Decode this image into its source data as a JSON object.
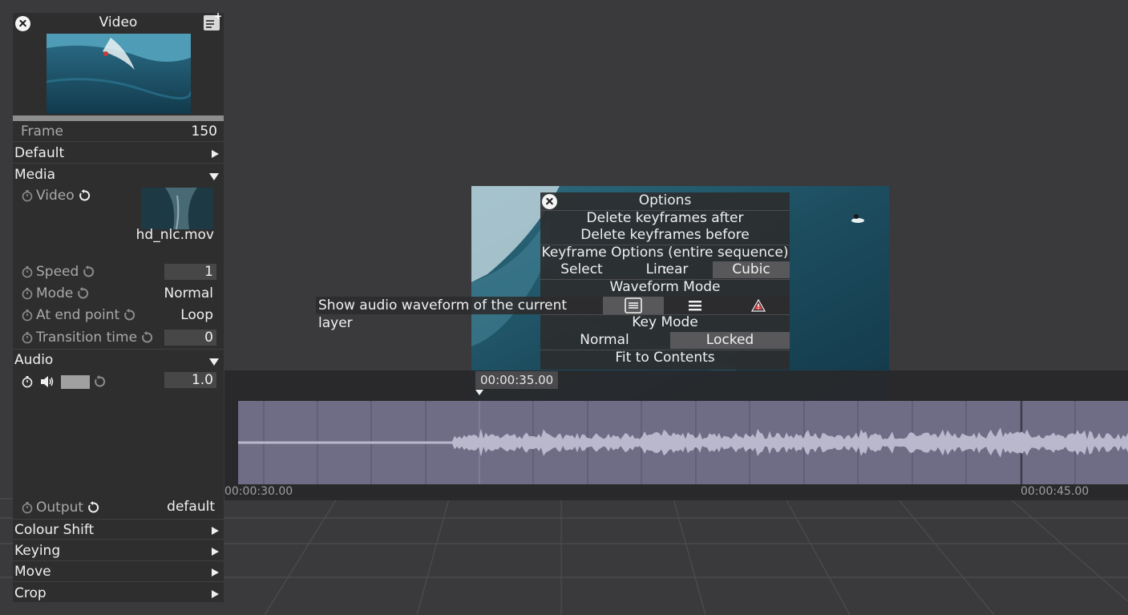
{
  "panel": {
    "title": "Video",
    "frame_label": "Frame",
    "frame_value": "150",
    "sections": {
      "default": "Default",
      "media": "Media",
      "audio": "Audio",
      "colour_shift": "Colour Shift",
      "keying": "Keying",
      "move": "Move",
      "crop": "Crop"
    },
    "media": {
      "video_label": "Video",
      "file_name": "hd_nlc.mov",
      "speed_label": "Speed",
      "speed_value": "1",
      "mode_label": "Mode",
      "mode_value": "Normal",
      "end_point_label": "At end point",
      "end_point_value": "Loop",
      "transition_label": "Transition time",
      "transition_value": "0"
    },
    "audio": {
      "volume_value": "1.0",
      "output_label": "Output",
      "output_value": "default"
    }
  },
  "options": {
    "title": "Options",
    "delete_after": "Delete keyframes after",
    "delete_before": "Delete keyframes before",
    "keyframe_options": "Keyframe Options (entire sequence) :",
    "interp": [
      "Select",
      "Linear",
      "Cubic"
    ],
    "interp_selected": "Cubic",
    "waveform_mode": "Waveform Mode",
    "waveform_tooltip": "Show audio waveform of the current layer",
    "key_mode": "Key Mode",
    "key_modes": [
      "Normal",
      "Locked"
    ],
    "key_mode_selected": "Locked",
    "fit": "Fit to Contents"
  },
  "timeline": {
    "playhead_time": "00:00:35.00",
    "start_label": "00:00:30.00",
    "end_label": "00:00:45.00"
  },
  "colors": {
    "panel_bg": "#2e2e2f",
    "background": "#3a3a3c",
    "waveform_track": "#6f6d86",
    "waveform": "#b9b8cc",
    "selected_segment": "#58585a",
    "warning": "#e0434b"
  },
  "icons": {
    "close": "close-icon",
    "notes": "add-note-icon",
    "stopwatch": "stopwatch-icon",
    "reset": "reset-icon",
    "speaker": "speaker-icon",
    "waveform_box": "waveform-box-icon",
    "waveform_lines": "waveform-lines-icon",
    "warning": "warning-triangle-icon"
  }
}
